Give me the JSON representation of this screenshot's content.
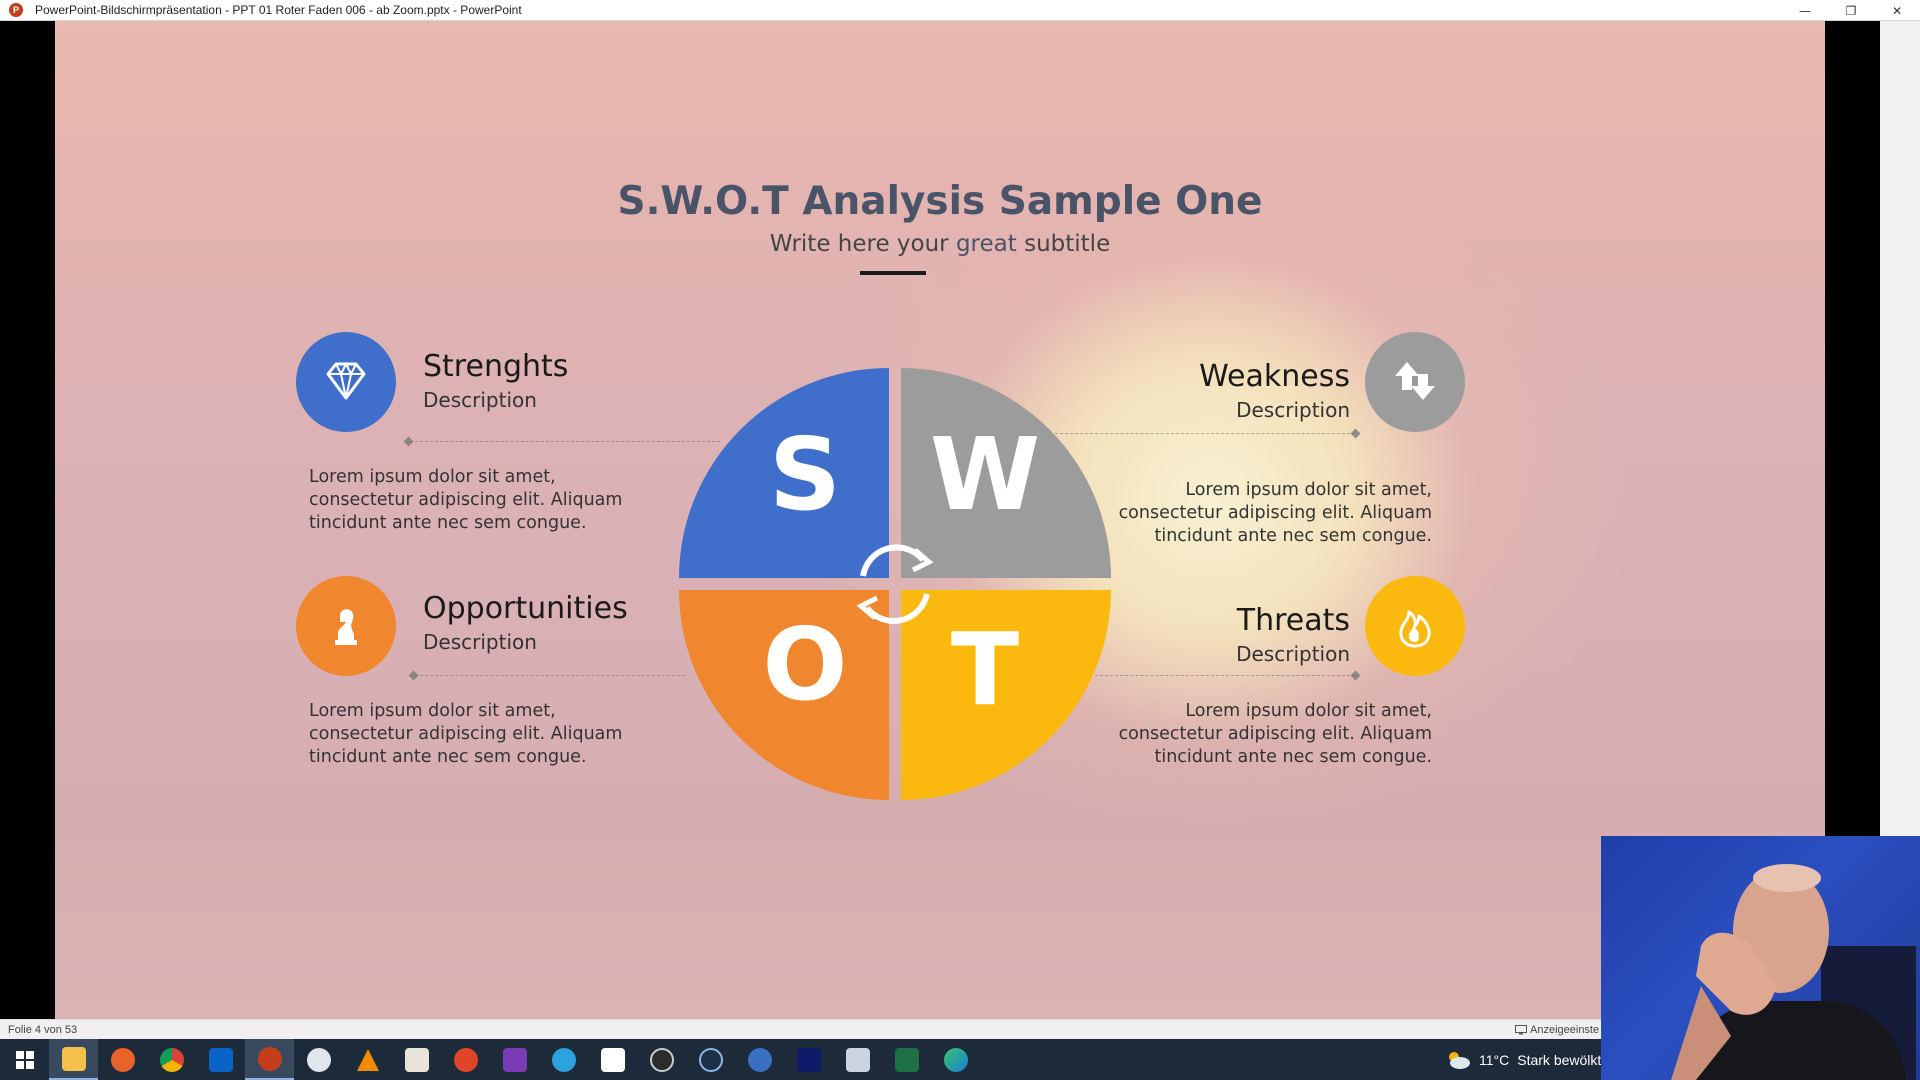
{
  "window": {
    "title": "PowerPoint-Bildschirmpräsentation  -  PPT 01 Roter Faden 006 - ab Zoom.pptx - PowerPoint",
    "app_icon_letter": "P",
    "minimize": "—",
    "restore": "❐",
    "close": "✕"
  },
  "slide": {
    "title": "S.W.O.T Analysis Sample One",
    "subtitle_before": "Write here your",
    "subtitle_highlight": "great",
    "subtitle_after": "subtitle",
    "swot_letters": [
      "S",
      "W",
      "O",
      "T"
    ],
    "items": {
      "strengths": {
        "title": "Strenghts",
        "desc": "Description",
        "body": "Lorem ipsum dolor sit amet, consectetur adipiscing elit. Aliquam tincidunt ante nec sem congue."
      },
      "weakness": {
        "title": "Weakness",
        "desc": "Description",
        "body": "Lorem ipsum dolor sit amet, consectetur adipiscing elit. Aliquam tincidunt ante nec sem congue."
      },
      "opportunities": {
        "title": "Opportunities",
        "desc": "Description",
        "body": "Lorem ipsum dolor sit amet, consectetur adipiscing elit. Aliquam tincidunt ante nec sem congue."
      },
      "threats": {
        "title": "Threats",
        "desc": "Description",
        "body": "Lorem ipsum dolor sit amet, consectetur adipiscing elit. Aliquam tincidunt ante nec sem congue."
      }
    },
    "colors": {
      "s": "#3f6fcb",
      "w": "#9c9c9c",
      "o": "#f0872e",
      "t": "#fbb80e"
    }
  },
  "status": {
    "slide_counter": "Folie 4 von 53",
    "display_settings": "Anzeigeeinste"
  },
  "taskbar": {
    "apps": [
      "windows-start",
      "file-explorer",
      "firefox",
      "chrome",
      "outlook",
      "powerpoint",
      "mail-app",
      "vlc",
      "app-doc",
      "app-red",
      "onenote",
      "telegram",
      "acrobat",
      "obs",
      "app-circle",
      "app-blue",
      "word-app",
      "app-monitor",
      "excel",
      "edge"
    ],
    "weather": {
      "temp": "11°C",
      "condition": "Stark bewölkt"
    }
  }
}
